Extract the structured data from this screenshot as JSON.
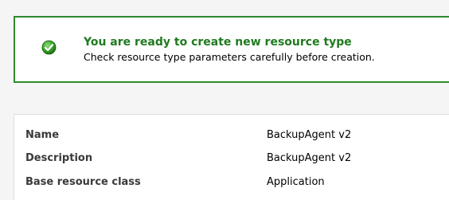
{
  "summary": {
    "title": "You are ready to create new resource type",
    "subtitle": "Check resource type parameters carefully before creation."
  },
  "parameters": [
    {
      "label": "Name",
      "value": "BackupAgent v2"
    },
    {
      "label": "Description",
      "value": "BackupAgent v2"
    },
    {
      "label": "Base resource class",
      "value": "Application"
    }
  ],
  "colors": {
    "accent_green": "#2e8b2e",
    "title_green": "#1f7a1f"
  },
  "icons": {
    "status": "check-circle-icon"
  }
}
